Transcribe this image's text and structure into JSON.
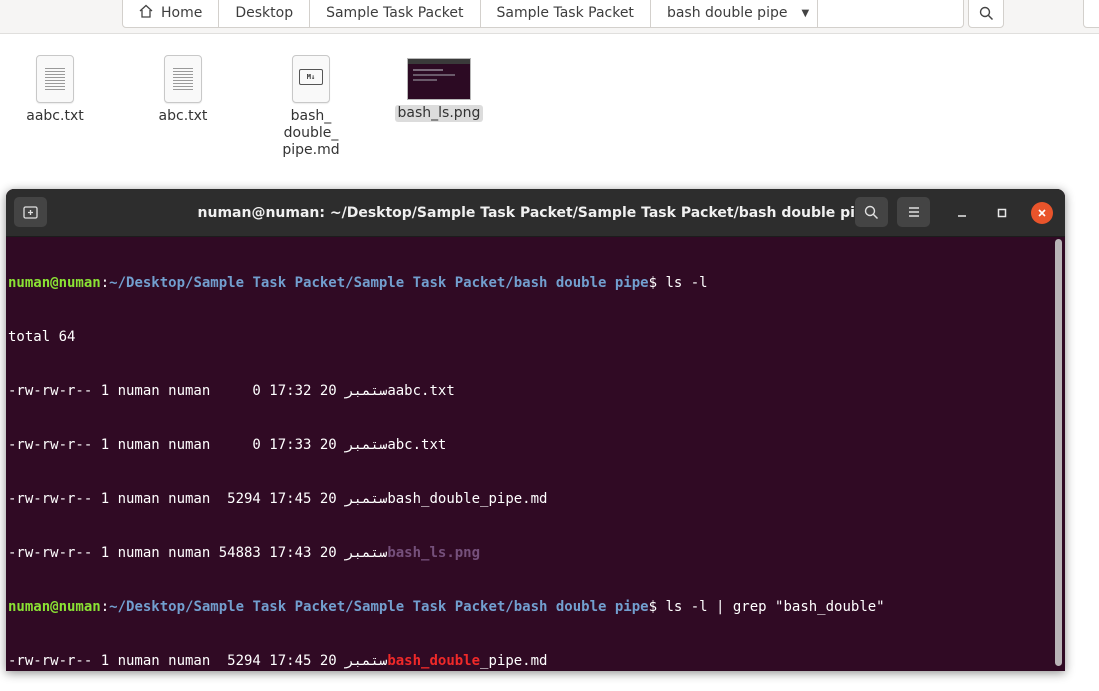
{
  "pathbar": {
    "crumbs": [
      "Home",
      "Desktop",
      "Sample Task Packet",
      "Sample Task Packet",
      "bash double pipe"
    ]
  },
  "files": [
    {
      "name": "aabc.txt",
      "type": "text"
    },
    {
      "name": "abc.txt",
      "type": "text"
    },
    {
      "name": "bash_\ndouble_\npipe.md",
      "type": "markdown",
      "badge": "M↓"
    },
    {
      "name": "bash_ls.png",
      "type": "image",
      "selected": true
    }
  ],
  "terminal": {
    "title": "numan@numan: ~/Desktop/Sample Task Packet/Sample Task Packet/bash double pipe",
    "user": "numan@numan",
    "path": "~/Desktop/Sample Task Packet/Sample Task Packet/bash double pipe",
    "cmd1": "ls -l",
    "total": "total 64",
    "rows": [
      {
        "meta": "-rw-rw-r-- 1 numan numan     0 17:32 20 ",
        "month": "ستمبر",
        "file": "aabc.txt"
      },
      {
        "meta": "-rw-rw-r-- 1 numan numan     0 17:33 20 ",
        "month": "ستمبر",
        "file": "abc.txt"
      },
      {
        "meta": "-rw-rw-r-- 1 numan numan  5294 17:45 20 ",
        "month": "ستمبر",
        "file": "bash_double_pipe.md"
      },
      {
        "meta": "-rw-rw-r-- 1 numan numan 54883 17:43 20 ",
        "month": "ستمبر",
        "file": "bash_ls.png"
      }
    ],
    "cmd2": "ls -l | grep \"bash_double\"",
    "grep_row": {
      "meta": "-rw-rw-r-- 1 numan numan  5294 17:45 20 ",
      "month": "ستمبر",
      "match": "bash_double",
      "rest": "_pipe.md"
    }
  },
  "colors": {
    "terminal_bg": "#300a24",
    "prompt_user": "#8ae234",
    "prompt_path": "#729fcf",
    "grep_match": "#ef2929",
    "close_button": "#e9542b"
  }
}
